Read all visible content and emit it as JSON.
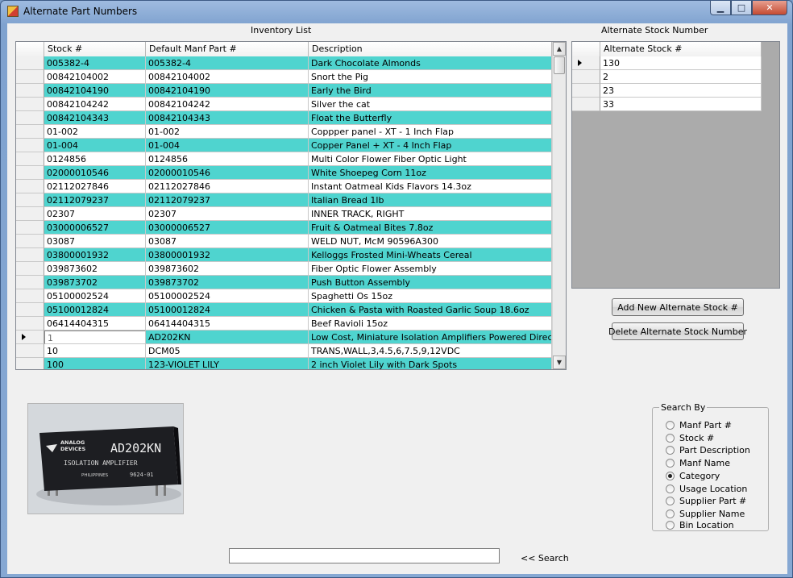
{
  "window": {
    "title": "Alternate Part Numbers",
    "controls": {
      "minimize": "▁",
      "maximize": "□",
      "close": "✕"
    }
  },
  "inventory": {
    "title": "Inventory List",
    "columns": [
      "Stock #",
      "Default Manf Part #",
      "Description"
    ],
    "rows": [
      [
        "005382-4",
        "005382-4",
        "Dark Chocolate Almonds"
      ],
      [
        "00842104002",
        "00842104002",
        "Snort the Pig"
      ],
      [
        "00842104190",
        "00842104190",
        "Early the Bird"
      ],
      [
        "00842104242",
        "00842104242",
        "Silver the cat"
      ],
      [
        "00842104343",
        "00842104343",
        "Float the Butterfly"
      ],
      [
        "01-002",
        "01-002",
        "Coppper panel - XT - 1 Inch Flap"
      ],
      [
        "01-004",
        "01-004",
        "Copper Panel + XT - 4 Inch Flap"
      ],
      [
        "0124856",
        "0124856",
        "Multi Color Flower Fiber Optic Light"
      ],
      [
        "02000010546",
        "02000010546",
        "White Shoepeg Corn 11oz"
      ],
      [
        "02112027846",
        "02112027846",
        "Instant Oatmeal Kids Flavors 14.3oz"
      ],
      [
        "02112079237",
        "02112079237",
        "Italian Bread 1lb"
      ],
      [
        "02307",
        "02307",
        "INNER TRACK, RIGHT"
      ],
      [
        "03000006527",
        "03000006527",
        "Fruit & Oatmeal Bites 7.8oz"
      ],
      [
        "03087",
        "03087",
        "WELD NUT, McM 90596A300"
      ],
      [
        "03800001932",
        "03800001932",
        "Kelloggs Frosted Mini-Wheats Cereal"
      ],
      [
        "039873602",
        "039873602",
        "Fiber Optic Flower Assembly"
      ],
      [
        "039873702",
        "039873702",
        "Push Button Assembly"
      ],
      [
        "05100002524",
        "05100002524",
        "Spaghetti Os 15oz"
      ],
      [
        "05100012824",
        "05100012824",
        "Chicken & Pasta with Roasted Garlic Soup 18.6oz"
      ],
      [
        "06414404315",
        "06414404315",
        "Beef Ravioli 15oz"
      ],
      [
        "1",
        "AD202KN",
        "Low Cost, Miniature Isolation Amplifiers Powered Directly Fr"
      ],
      [
        "10",
        "DCM05",
        "TRANS,WALL,3,4.5,6,7.5,9,12VDC"
      ],
      [
        "100",
        "123-VIOLET LILY",
        "2 inch Violet Lily with Dark Spots"
      ]
    ],
    "current_row": 20
  },
  "alternate": {
    "title": "Alternate Stock Number",
    "column": "Alternate Stock #",
    "rows": [
      "130",
      "2",
      "23",
      "33"
    ],
    "current_row": 0
  },
  "buttons": {
    "add": "Add New Alternate Stock #",
    "delete": "Delete Alternate Stock Number"
  },
  "photo": {
    "chip_brand_line1": "ANALOG",
    "chip_brand_line2": "DEVICES",
    "chip_part": "AD202KN",
    "chip_line2": "ISOLATION AMPLIFIER",
    "chip_origin": "PHILIPPINES",
    "chip_code": "9624-01"
  },
  "search_by": {
    "legend": "Search By",
    "options": [
      "Manf Part #",
      "Stock #",
      "Part Description",
      "Manf Name",
      "Category",
      "Usage Location",
      "Supplier Part #",
      "Supplier Name",
      "Bin Location"
    ],
    "selected": "Category"
  },
  "search": {
    "value": "",
    "button_label": "<< Search"
  },
  "colors": {
    "alt_row": "#4fd4cf",
    "window_frame": "#86a8d3"
  }
}
